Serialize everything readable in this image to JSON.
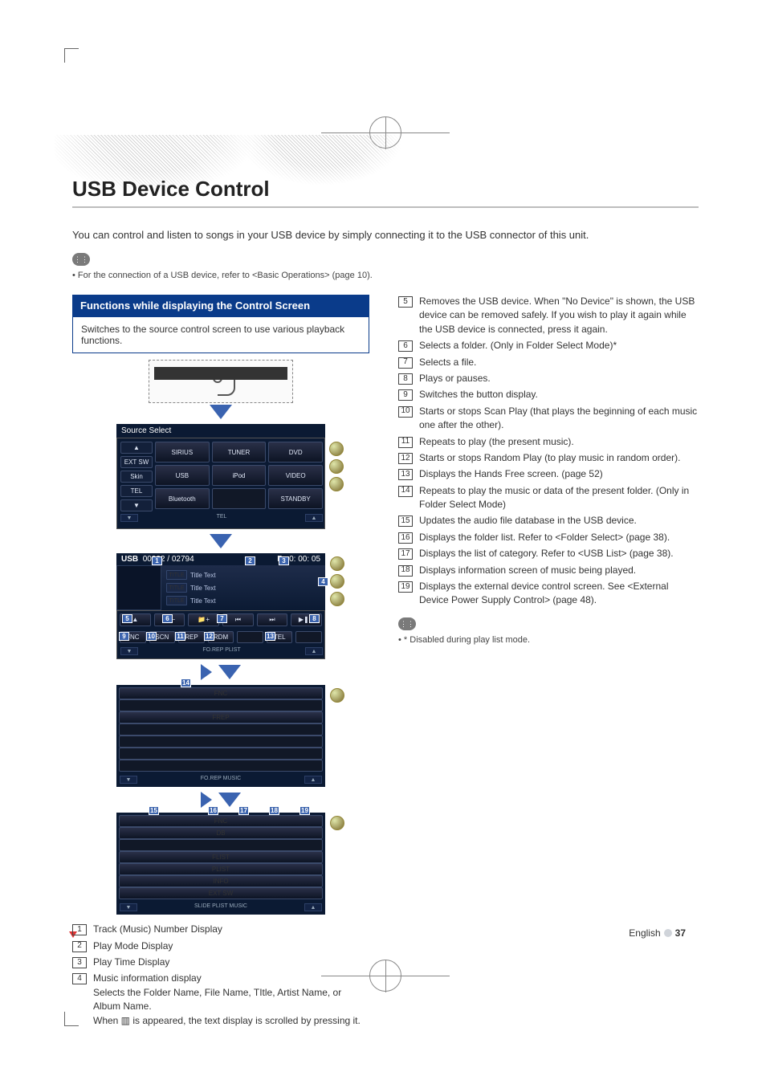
{
  "title": "USB Device Control",
  "intro": "You can control and listen to songs in your USB device by simply connecting it to the USB connector of this unit.",
  "connection_note_bullet": "For the connection of a USB device, refer to <Basic Operations> (page 10).",
  "func_header": "Functions while displaying the Control Screen",
  "func_body": "Switches to the source control screen to use various playback functions.",
  "source_select_title": "Source Select",
  "source_grid": {
    "row1": [
      "SIRIUS",
      "TUNER",
      "DVD"
    ],
    "row2": [
      "USB",
      "iPod",
      "VIDEO"
    ],
    "row3": [
      "Bluetooth",
      "",
      "STANDBY"
    ],
    "left_small": [
      "EXT SW",
      "Skin",
      "TEL"
    ]
  },
  "usb_header": {
    "label": "USB",
    "counter": "00002  /  02794",
    "pmode": "P",
    "time": "0: 00: 05"
  },
  "title_text_lines": [
    "Title Text",
    "Title Text",
    "Title Text"
  ],
  "scroll_btn_label": "TITLE",
  "transport_labels": {
    "scan": "SCN",
    "rep": "REP",
    "rdm": "RDM",
    "tel": "TEL",
    "sub": "FO.REP   PLIST"
  },
  "frep_row": {
    "frep": "FREP",
    "sub": "FO.REP          MUSIC"
  },
  "slide_row": {
    "db": "DB",
    "flist": "FLIST",
    "plist": "PLIST",
    "info": "INFO",
    "extsw": "EXT SW",
    "sub": "SLIDE      PLIST   MUSIC"
  },
  "left_items": [
    {
      "n": "1",
      "t": "Track (Music) Number Display"
    },
    {
      "n": "2",
      "t": "Play Mode Display"
    },
    {
      "n": "3",
      "t": "Play Time Display"
    },
    {
      "n": "4",
      "t": "Music information display",
      "extra": "Selects the Folder Name, File Name, TItle, Artist Name, or Album Name.\nWhen ▥ is appeared, the text display is scrolled by pressing it."
    }
  ],
  "right_items": [
    {
      "n": "5",
      "t": "Removes the USB device.\nWhen \"No Device\" is shown, the USB device can be removed safely.\nIf you wish to play it again while the USB device is connected, press it again."
    },
    {
      "n": "6",
      "t": "Selects a folder. (Only in Folder Select Mode)*"
    },
    {
      "n": "7",
      "t": "Selects a file."
    },
    {
      "n": "8",
      "t": "Plays or pauses."
    },
    {
      "n": "9",
      "t": "Switches the button display."
    },
    {
      "n": "10",
      "t": "Starts or stops Scan Play (that plays the beginning of each music one after the other)."
    },
    {
      "n": "11",
      "t": "Repeats to play (the present music)."
    },
    {
      "n": "12",
      "t": "Starts or stops Random Play (to play music in random order)."
    },
    {
      "n": "13",
      "t": "Displays the Hands Free screen. (page 52)"
    },
    {
      "n": "14",
      "t": "Repeats to play the music or data of the present folder. (Only in Folder Select Mode)"
    },
    {
      "n": "15",
      "t": "Updates the audio file database in the USB device."
    },
    {
      "n": "16",
      "t": "Displays the folder list. Refer to <Folder Select> (page 38)."
    },
    {
      "n": "17",
      "t": "Displays the list of category. Refer to <USB List> (page 38)."
    },
    {
      "n": "18",
      "t": "Displays information screen of music being played."
    },
    {
      "n": "19",
      "t": "Displays the external device control screen. See <External Device Power Supply Control> (page 48)."
    }
  ],
  "disabled_note": "* Disabled during play list mode.",
  "footer_lang": "English",
  "footer_page": "37"
}
